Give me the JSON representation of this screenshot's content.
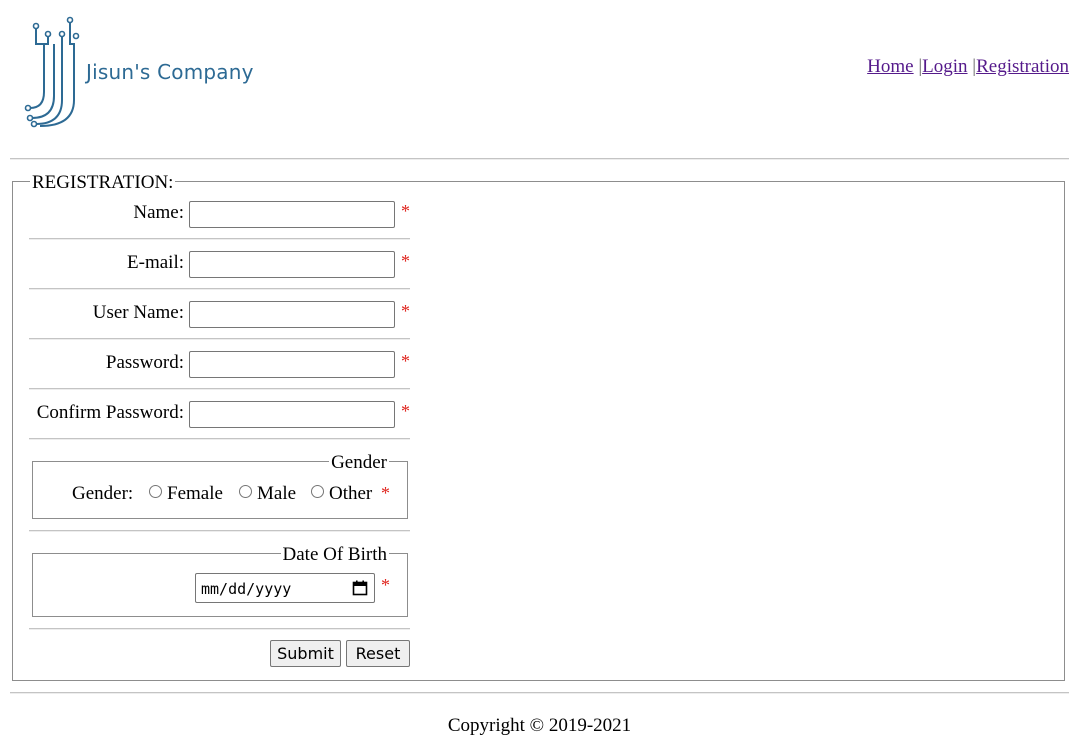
{
  "header": {
    "brand": "Jisun's Company",
    "nav": [
      {
        "label": "Home",
        "sep": ""
      },
      {
        "label": "Login",
        "sep": " |"
      },
      {
        "label": "Registration",
        "sep": " |"
      }
    ]
  },
  "form": {
    "legend": "REGISTRATION:",
    "required_mark": "*",
    "fields": {
      "name": {
        "label": "Name:",
        "value": ""
      },
      "email": {
        "label": "E-mail:",
        "value": ""
      },
      "username": {
        "label": "User Name:",
        "value": ""
      },
      "password": {
        "label": "Password:",
        "value": ""
      },
      "confirm_password": {
        "label": "Confirm Password:",
        "value": ""
      }
    },
    "gender": {
      "legend": "Gender",
      "label": "Gender:",
      "options": [
        "Female",
        "Male",
        "Other"
      ]
    },
    "dob": {
      "legend": "Date Of Birth",
      "placeholder": "mm/dd/yyyy"
    },
    "buttons": {
      "submit": "Submit",
      "reset": "Reset"
    }
  },
  "footer": {
    "copyright": "Copyright © 2019-2021"
  },
  "colors": {
    "brand": "#2d6a94",
    "required": "#e0261f",
    "link": "#551a8b"
  }
}
